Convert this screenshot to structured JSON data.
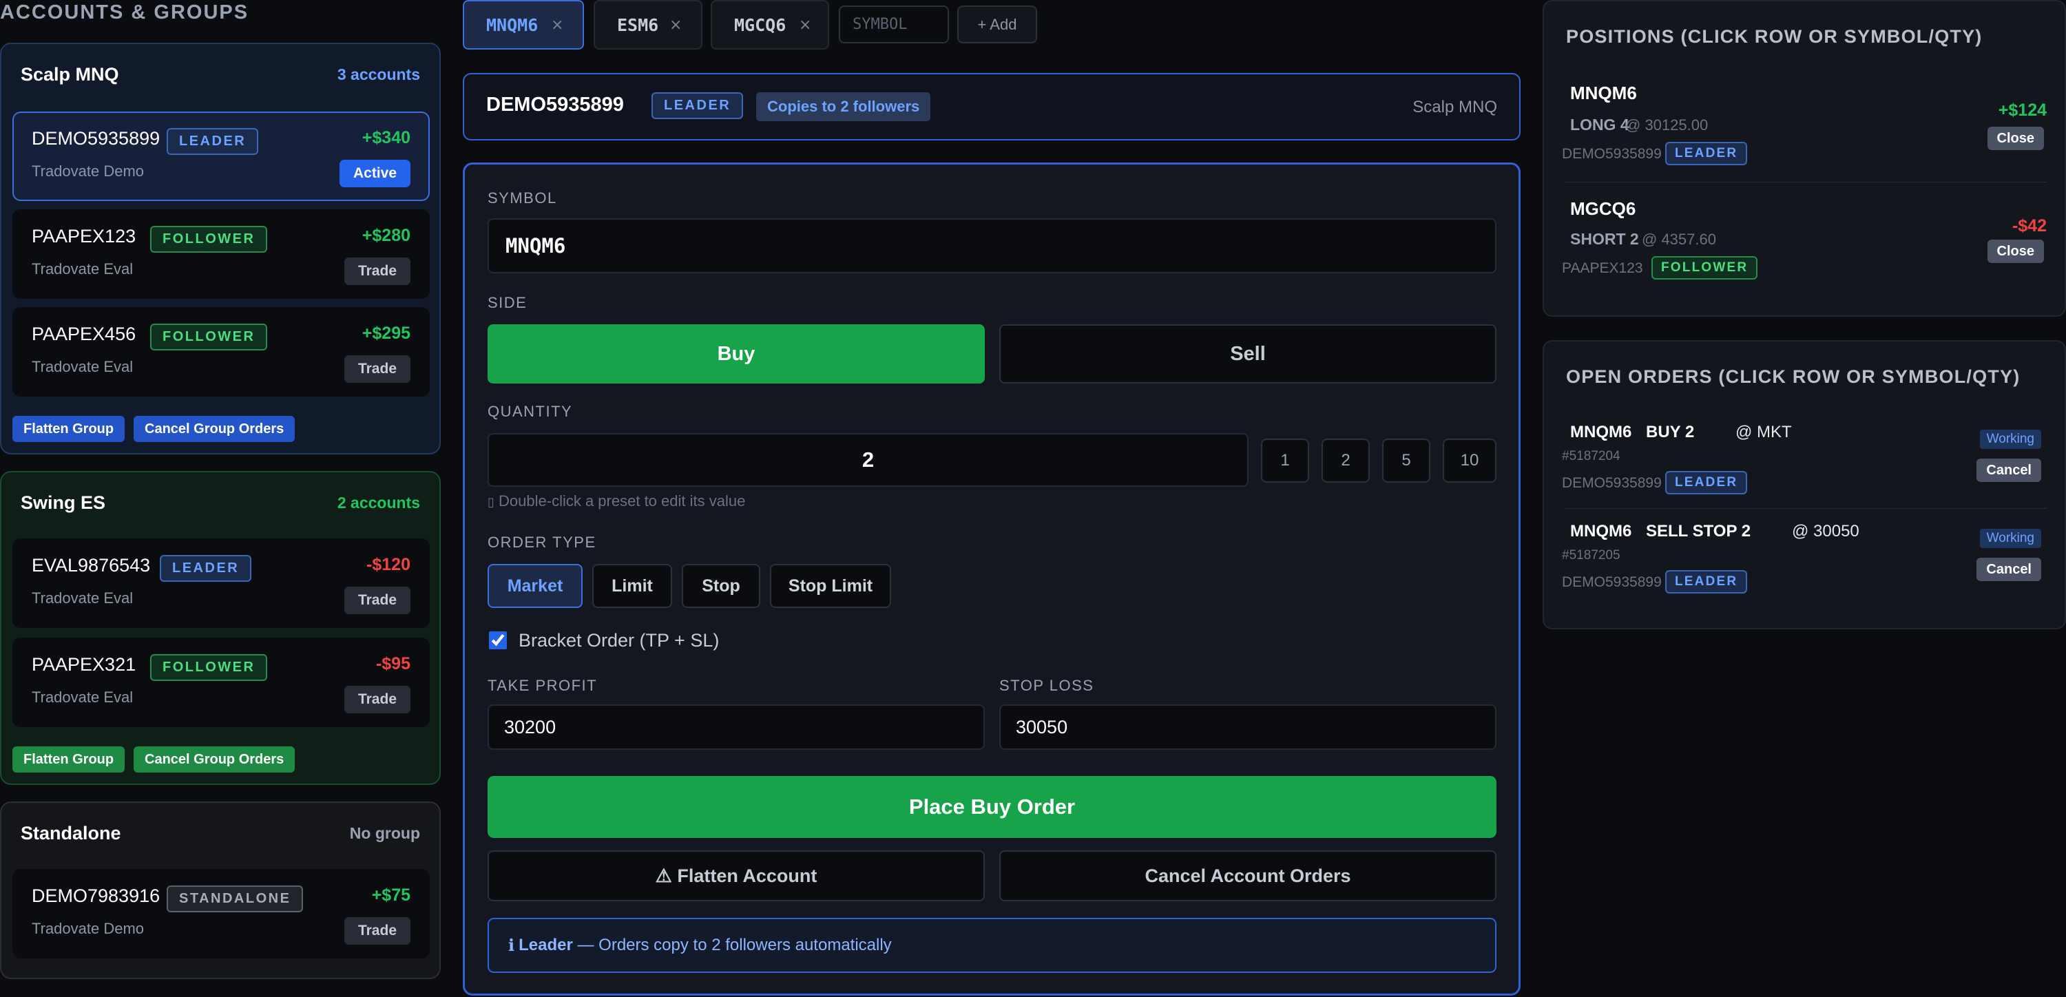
{
  "left": {
    "title": "ACCOUNTS & GROUPS",
    "groups": [
      {
        "name": "Scalp MNQ",
        "count": "3 accounts",
        "accounts": [
          {
            "id": "DEMO5935899",
            "role": "LEADER",
            "sub": "Tradovate Demo",
            "pnl": "+$340",
            "button": "Active"
          },
          {
            "id": "PAAPEX123",
            "role": "FOLLOWER",
            "sub": "Tradovate Eval",
            "pnl": "+$280",
            "button": "Trade"
          },
          {
            "id": "PAAPEX456",
            "role": "FOLLOWER",
            "sub": "Tradovate Eval",
            "pnl": "+$295",
            "button": "Trade"
          }
        ],
        "flatten": "Flatten Group",
        "cancel": "Cancel Group Orders"
      },
      {
        "name": "Swing ES",
        "count": "2 accounts",
        "accounts": [
          {
            "id": "EVAL9876543",
            "role": "LEADER",
            "sub": "Tradovate Eval",
            "pnl": "-$120",
            "button": "Trade"
          },
          {
            "id": "PAAPEX321",
            "role": "FOLLOWER",
            "sub": "Tradovate Eval",
            "pnl": "-$95",
            "button": "Trade"
          }
        ],
        "flatten": "Flatten Group",
        "cancel": "Cancel Group Orders"
      },
      {
        "name": "Standalone",
        "count": "No group",
        "accounts": [
          {
            "id": "DEMO7983916",
            "role": "STANDALONE",
            "sub": "Tradovate Demo",
            "pnl": "+$75",
            "button": "Trade"
          }
        ]
      }
    ]
  },
  "tabs": [
    {
      "symbol": "MNQM6",
      "close": "×"
    },
    {
      "symbol": "ESM6",
      "close": "×"
    },
    {
      "symbol": "MGCQ6",
      "close": "×"
    }
  ],
  "symbol_input": {
    "placeholder": "SYMBOL"
  },
  "add_tab": "+ Add",
  "banner": {
    "account": "DEMO5935899",
    "role": "LEADER",
    "copies": "Copies to 2 followers",
    "group": "Scalp MNQ"
  },
  "order": {
    "symbol_label": "SYMBOL",
    "symbol_value": "MNQM6",
    "side_label": "SIDE",
    "buy": "Buy",
    "sell": "Sell",
    "quantity_label": "QUANTITY",
    "quantity_value": "2",
    "presets": [
      "1",
      "2",
      "5",
      "10"
    ],
    "preset_hint": "Double-click a preset to edit its value",
    "hint_glyph": "▯",
    "order_type_label": "ORDER TYPE",
    "order_types": [
      "Market",
      "Limit",
      "Stop",
      "Stop Limit"
    ],
    "selected_order_type": "Market",
    "bracket_label": "Bracket Order (TP + SL)",
    "bracket_checked": true,
    "take_profit_label": "TAKE PROFIT",
    "take_profit_value": "30200",
    "stop_loss_label": "STOP LOSS",
    "stop_loss_value": "30050",
    "place_button": "Place Buy Order",
    "flatten_button": "⚠ Flatten Account",
    "cancel_button": "Cancel Account Orders",
    "info_icon": "ℹ",
    "info_strong": "Leader",
    "info_text": " — Orders copy to 2 followers automatically"
  },
  "positions": {
    "title": "POSITIONS (CLICK ROW OR SYMBOL/QTY)",
    "rows": [
      {
        "symbol": "MNQM6",
        "side": "LONG 4",
        "price": "@ 30125.00",
        "account": "DEMO5935899",
        "role": "LEADER",
        "pnl": "+$124",
        "button": "Close"
      },
      {
        "symbol": "MGCQ6",
        "side": "SHORT 2",
        "price": "@ 4357.60",
        "account": "PAAPEX123",
        "role": "FOLLOWER",
        "pnl": "-$42",
        "button": "Close"
      }
    ]
  },
  "open_orders": {
    "title": "OPEN ORDERS (CLICK ROW OR SYMBOL/QTY)",
    "rows": [
      {
        "symbol": "MNQM6",
        "action": "BUY 2",
        "price": "@ MKT",
        "order_id": "#5187204",
        "account": "DEMO5935899",
        "role": "LEADER",
        "status": "Working",
        "button": "Cancel"
      },
      {
        "symbol": "MNQM6",
        "action": "SELL STOP 2",
        "price": "@ 30050",
        "order_id": "#5187205",
        "account": "DEMO5935899",
        "role": "LEADER",
        "status": "Working",
        "button": "Cancel"
      }
    ]
  },
  "colors": {
    "accent_blue": "#2463eb",
    "buy_green": "#16a34a",
    "profit_green": "#22c55e",
    "loss_red": "#ef4444",
    "scalp_group_bg": "#101a2a",
    "swing_group_bg": "#0f1f17",
    "standalone_group_bg": "#15161a"
  }
}
